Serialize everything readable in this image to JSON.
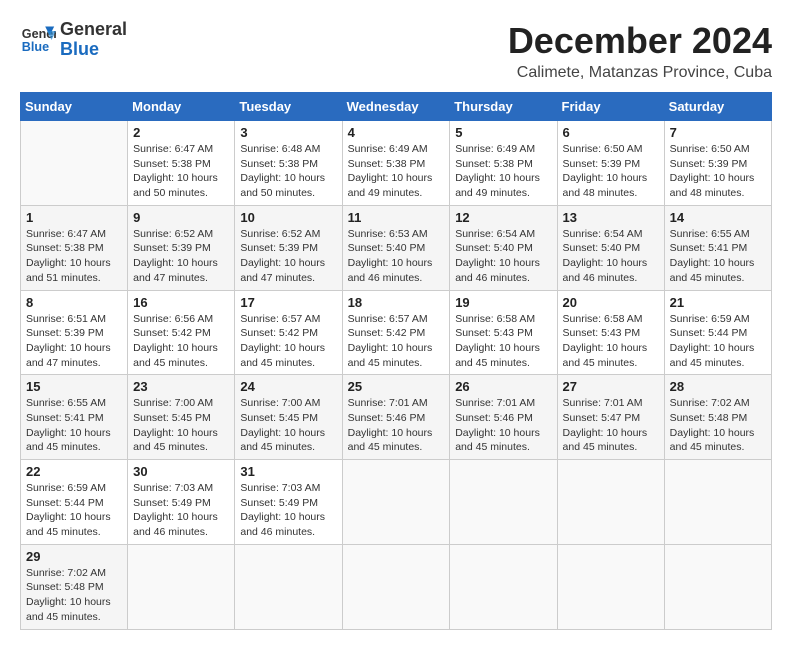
{
  "header": {
    "logo_general": "General",
    "logo_blue": "Blue",
    "title": "December 2024",
    "subtitle": "Calimete, Matanzas Province, Cuba"
  },
  "calendar": {
    "days_of_week": [
      "Sunday",
      "Monday",
      "Tuesday",
      "Wednesday",
      "Thursday",
      "Friday",
      "Saturday"
    ],
    "weeks": [
      [
        null,
        {
          "day": "2",
          "sunrise": "6:47 AM",
          "sunset": "5:38 PM",
          "daylight": "10 hours and 50 minutes."
        },
        {
          "day": "3",
          "sunrise": "6:48 AM",
          "sunset": "5:38 PM",
          "daylight": "10 hours and 50 minutes."
        },
        {
          "day": "4",
          "sunrise": "6:49 AM",
          "sunset": "5:38 PM",
          "daylight": "10 hours and 49 minutes."
        },
        {
          "day": "5",
          "sunrise": "6:49 AM",
          "sunset": "5:38 PM",
          "daylight": "10 hours and 49 minutes."
        },
        {
          "day": "6",
          "sunrise": "6:50 AM",
          "sunset": "5:39 PM",
          "daylight": "10 hours and 48 minutes."
        },
        {
          "day": "7",
          "sunrise": "6:50 AM",
          "sunset": "5:39 PM",
          "daylight": "10 hours and 48 minutes."
        }
      ],
      [
        {
          "day": "1",
          "sunrise": "6:47 AM",
          "sunset": "5:38 PM",
          "daylight": "10 hours and 51 minutes."
        },
        {
          "day": "9",
          "sunrise": "6:52 AM",
          "sunset": "5:39 PM",
          "daylight": "10 hours and 47 minutes."
        },
        {
          "day": "10",
          "sunrise": "6:52 AM",
          "sunset": "5:39 PM",
          "daylight": "10 hours and 47 minutes."
        },
        {
          "day": "11",
          "sunrise": "6:53 AM",
          "sunset": "5:40 PM",
          "daylight": "10 hours and 46 minutes."
        },
        {
          "day": "12",
          "sunrise": "6:54 AM",
          "sunset": "5:40 PM",
          "daylight": "10 hours and 46 minutes."
        },
        {
          "day": "13",
          "sunrise": "6:54 AM",
          "sunset": "5:40 PM",
          "daylight": "10 hours and 46 minutes."
        },
        {
          "day": "14",
          "sunrise": "6:55 AM",
          "sunset": "5:41 PM",
          "daylight": "10 hours and 45 minutes."
        }
      ],
      [
        {
          "day": "8",
          "sunrise": "6:51 AM",
          "sunset": "5:39 PM",
          "daylight": "10 hours and 47 minutes."
        },
        {
          "day": "16",
          "sunrise": "6:56 AM",
          "sunset": "5:42 PM",
          "daylight": "10 hours and 45 minutes."
        },
        {
          "day": "17",
          "sunrise": "6:57 AM",
          "sunset": "5:42 PM",
          "daylight": "10 hours and 45 minutes."
        },
        {
          "day": "18",
          "sunrise": "6:57 AM",
          "sunset": "5:42 PM",
          "daylight": "10 hours and 45 minutes."
        },
        {
          "day": "19",
          "sunrise": "6:58 AM",
          "sunset": "5:43 PM",
          "daylight": "10 hours and 45 minutes."
        },
        {
          "day": "20",
          "sunrise": "6:58 AM",
          "sunset": "5:43 PM",
          "daylight": "10 hours and 45 minutes."
        },
        {
          "day": "21",
          "sunrise": "6:59 AM",
          "sunset": "5:44 PM",
          "daylight": "10 hours and 45 minutes."
        }
      ],
      [
        {
          "day": "15",
          "sunrise": "6:55 AM",
          "sunset": "5:41 PM",
          "daylight": "10 hours and 45 minutes."
        },
        {
          "day": "23",
          "sunrise": "7:00 AM",
          "sunset": "5:45 PM",
          "daylight": "10 hours and 45 minutes."
        },
        {
          "day": "24",
          "sunrise": "7:00 AM",
          "sunset": "5:45 PM",
          "daylight": "10 hours and 45 minutes."
        },
        {
          "day": "25",
          "sunrise": "7:01 AM",
          "sunset": "5:46 PM",
          "daylight": "10 hours and 45 minutes."
        },
        {
          "day": "26",
          "sunrise": "7:01 AM",
          "sunset": "5:46 PM",
          "daylight": "10 hours and 45 minutes."
        },
        {
          "day": "27",
          "sunrise": "7:01 AM",
          "sunset": "5:47 PM",
          "daylight": "10 hours and 45 minutes."
        },
        {
          "day": "28",
          "sunrise": "7:02 AM",
          "sunset": "5:48 PM",
          "daylight": "10 hours and 45 minutes."
        }
      ],
      [
        {
          "day": "22",
          "sunrise": "6:59 AM",
          "sunset": "5:44 PM",
          "daylight": "10 hours and 45 minutes."
        },
        {
          "day": "30",
          "sunrise": "7:03 AM",
          "sunset": "5:49 PM",
          "daylight": "10 hours and 46 minutes."
        },
        {
          "day": "31",
          "sunrise": "7:03 AM",
          "sunset": "5:49 PM",
          "daylight": "10 hours and 46 minutes."
        },
        null,
        null,
        null,
        null
      ],
      [
        {
          "day": "29",
          "sunrise": "7:02 AM",
          "sunset": "5:48 PM",
          "daylight": "10 hours and 45 minutes."
        },
        null,
        null,
        null,
        null,
        null,
        null
      ]
    ],
    "labels": {
      "sunrise": "Sunrise:",
      "sunset": "Sunset:",
      "daylight": "Daylight:"
    }
  }
}
